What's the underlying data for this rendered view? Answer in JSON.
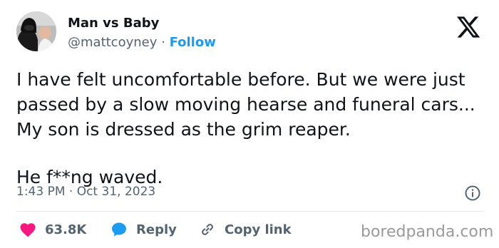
{
  "header": {
    "display_name": "Man vs Baby",
    "handle": "@mattcoyney",
    "separator": " · ",
    "follow_label": "Follow"
  },
  "tweet": {
    "paragraphs": [
      "I have felt uncomfortable before. But we were just passed by a slow moving hearse and funeral cars... My son is dressed as the grim reaper.",
      "He f**ng waved."
    ],
    "timestamp": "1:43 PM · Oct 31, 2023"
  },
  "actions": {
    "like_count": "63.8K",
    "reply_label": "Reply",
    "copy_link_label": "Copy link"
  },
  "watermark": "boredpanda.com",
  "icons": {
    "logo": "x-logo-icon",
    "like": "heart-icon",
    "reply": "speech-bubble-icon",
    "copy": "link-icon",
    "info": "info-icon"
  },
  "colors": {
    "text": "#0f1419",
    "secondary": "#536471",
    "accent": "#1d9bf0",
    "like": "#f91880"
  }
}
